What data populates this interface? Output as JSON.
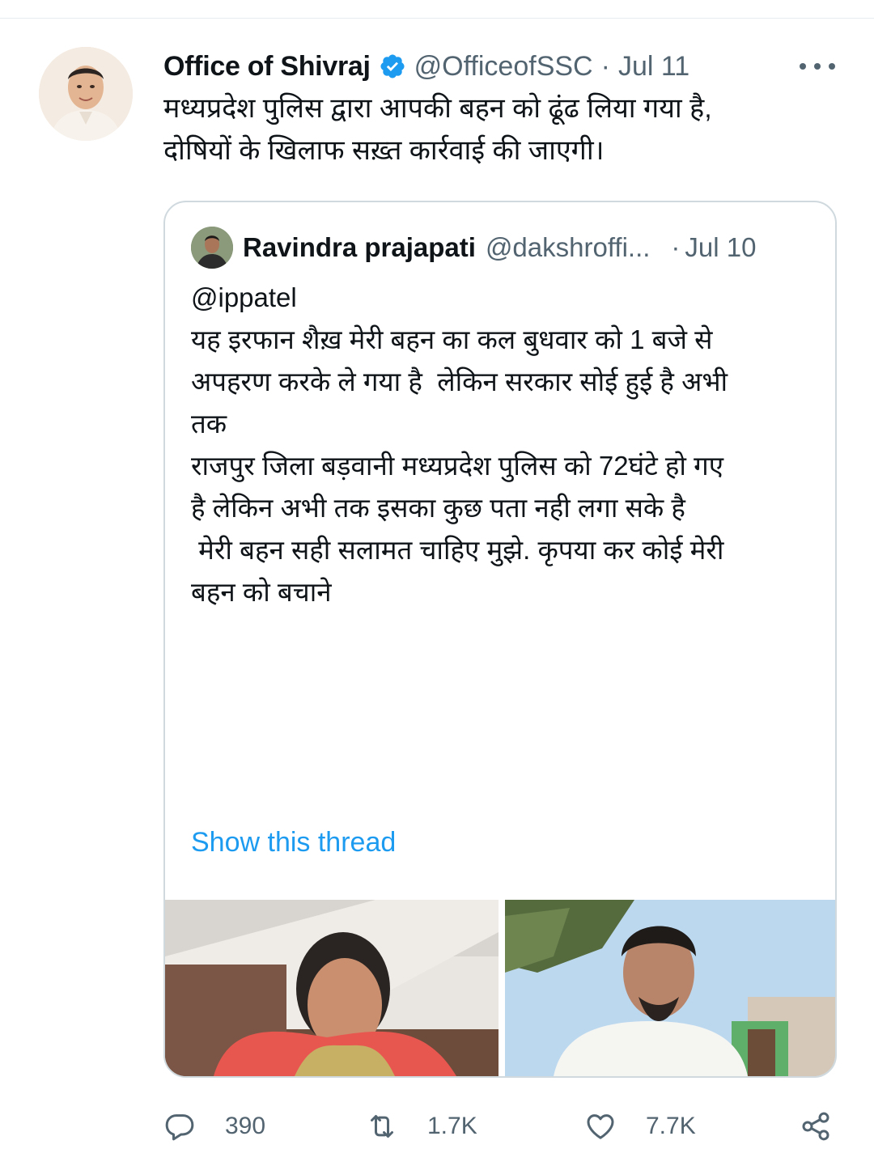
{
  "tweet": {
    "author_name": "Office of Shivraj",
    "handle": "@OfficeofSSC",
    "separator": "·",
    "date": "Jul 11",
    "text_lines": [
      "मध्यप्रदेश पुलिस द्वारा आपकी बहन को ढूंढ लिया गया है,",
      "दोषियों के खिलाफ सख़्त कार्रवाई की जाएगी।"
    ]
  },
  "quoted_tweet": {
    "author_name": "Ravindra prajapati",
    "handle": "@dakshroffi...",
    "separator": "·",
    "date": "Jul 10",
    "text_lines": [
      "@ippatel",
      "यह इरफान शैख़ मेरी बहन का कल बुधवार को 1 बजे से",
      "अपहरण करके ले गया है  लेकिन सरकार सोई हुई है अभी",
      "तक",
      "राजपुर जिला बड़वानी मध्यप्रदेश पुलिस को 72घंटे हो गए",
      "है लेकिन अभी तक इसका कुछ पता नही लगा सके है",
      " मेरी बहन सही सलामत चाहिए मुझे. कृपया कर कोई मेरी",
      "बहन को बचाने"
    ],
    "show_thread_label": "Show this thread"
  },
  "actions": {
    "replies": "390",
    "retweets": "1.7K",
    "likes": "7.7K"
  },
  "colors": {
    "accent": "#1d9bf0",
    "secondary_text": "#536471",
    "border": "#cfd9de"
  }
}
